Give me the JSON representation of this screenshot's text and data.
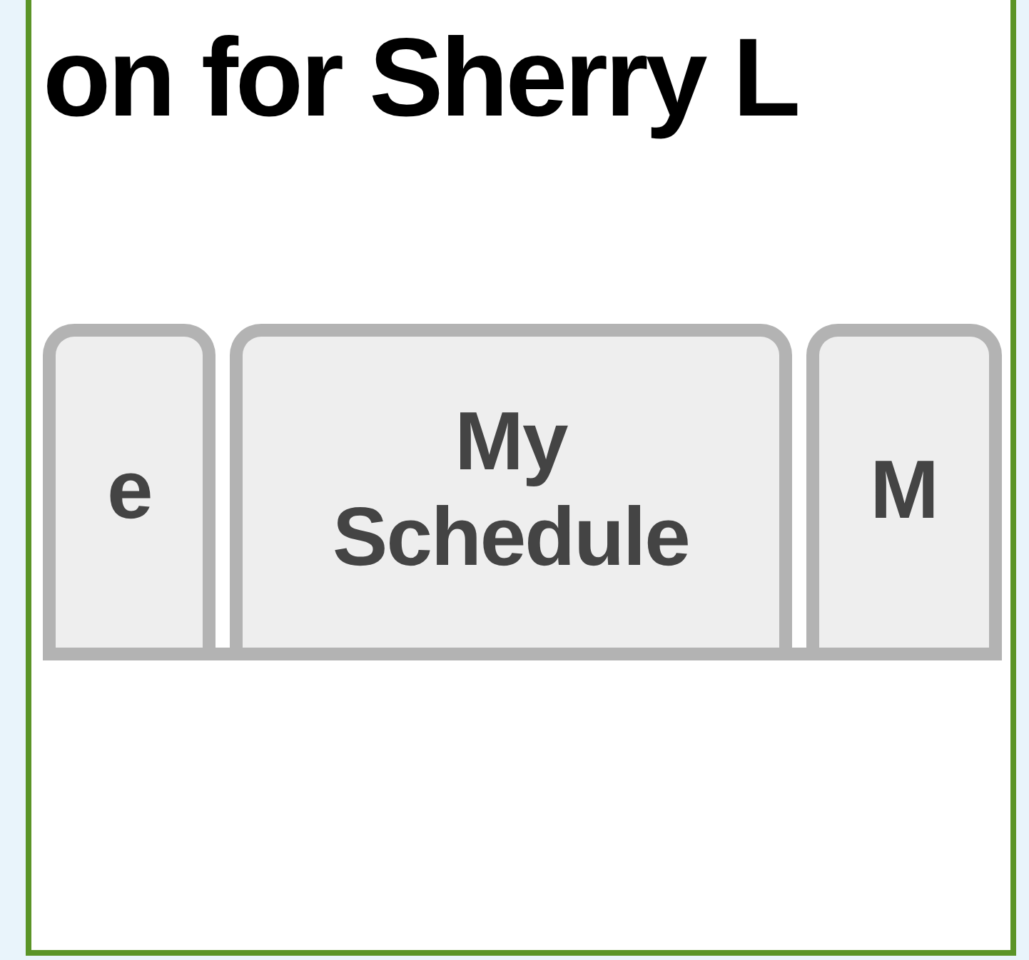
{
  "heading": "on for Sherry L",
  "tabs": [
    {
      "label": "e",
      "selected": false
    },
    {
      "label": "My Schedule",
      "selected": false
    },
    {
      "label": "M",
      "selected": false
    }
  ]
}
